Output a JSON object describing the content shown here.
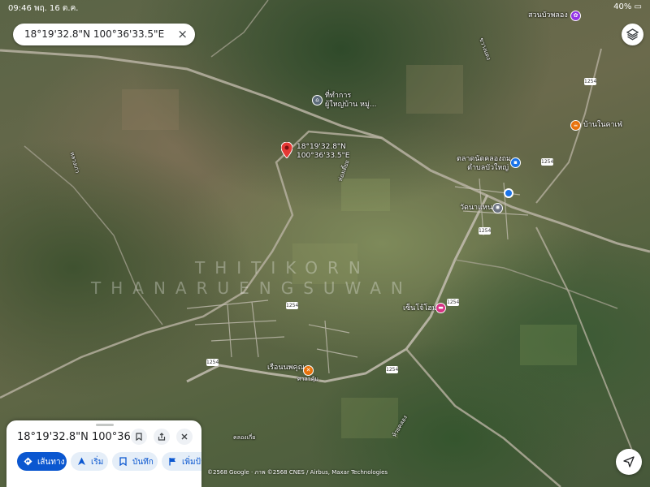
{
  "status_bar": {
    "time": "09:46",
    "date": "พฤ. 16 ต.ค.",
    "right": "40% ▭"
  },
  "search": {
    "query": "18°19'32.8\"N 100°36'33.5\"E",
    "close_icon": "×"
  },
  "map": {
    "pin": {
      "label_line1": "18°19'32.8\"N",
      "label_line2": "100°36'33.5\"E",
      "color": "#e53935"
    },
    "places": [
      {
        "name_line1": "ที่ทำการ",
        "name_line2": "ผู้ใหญ่บ้าน หมู่...",
        "icon": "government-icon"
      },
      {
        "name_line1": "ตลาดนัดคลองถม",
        "name_line2": "ตำบลบัวใหญ่",
        "icon": "shopping-icon"
      },
      {
        "name": "วัดนาแหน",
        "icon": "temple-icon"
      },
      {
        "name": "บ้านในคาเฟ่",
        "icon": "cafe-icon"
      },
      {
        "name": "เรือนนพคุณ",
        "icon": "restaurant-icon"
      },
      {
        "name": "เซ็นโจ้โฮม",
        "icon": "lodging-icon"
      },
      {
        "name": "สวนบัวพลอง",
        "icon": "park-icon"
      },
      {
        "name": "ศาลาคุ้ม",
        "icon": "label"
      }
    ],
    "road_labels": [
      "หลวงเก่า",
      "ขวางแดง",
      "ห่องเตี้ยย",
      "คลองเกี่ย",
      "ห้วยคลอง"
    ],
    "road_shields": [
      "1254",
      "1254",
      "1254",
      "1254",
      "1254",
      "1254",
      "1254"
    ],
    "watermark_line1": "THITIKORN",
    "watermark_line2": "THANARUENGSUWAN",
    "attribution": "©2568 Google · ภาพ ©2568 CNES / Airbus, Maxar Technologies"
  },
  "sheet": {
    "title": "18°19'32.8\"N 100°36'...",
    "actions": [
      {
        "label": "เส้นทาง",
        "icon": "directions-icon"
      },
      {
        "label": "เริ่ม",
        "icon": "navigation-icon"
      },
      {
        "label": "บันทึก",
        "icon": "bookmark-icon"
      },
      {
        "label": "เพิ่มป้า",
        "icon": "flag-icon"
      }
    ]
  },
  "colors": {
    "accent": "#0b57d0",
    "pin": "#e53935",
    "location_dot": "#1a73e8"
  }
}
